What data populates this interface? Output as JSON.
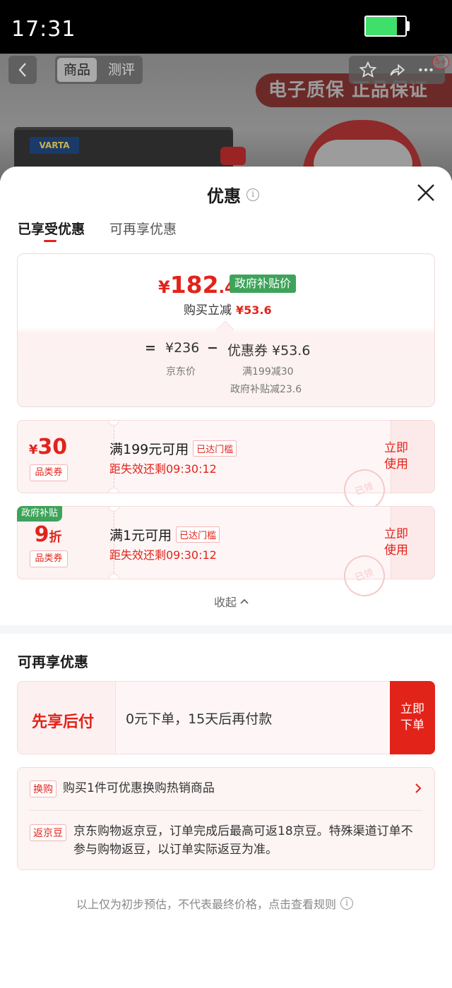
{
  "status_bar": {
    "time": "17:31",
    "battery_level": 0.78
  },
  "product": {
    "nav_tabs": [
      "商品",
      "测评"
    ],
    "banner_text": "电子质保 正品保证",
    "notification_count": "5+",
    "battery_brand": "VARTA"
  },
  "sheet": {
    "title": "优惠",
    "tabs": [
      "已享受优惠",
      "可再享优惠"
    ],
    "active_tab": "已享受优惠"
  },
  "summary": {
    "final_price_symbol": "¥",
    "final_price_int": "182",
    "final_price_dec": ".4",
    "gov_tag": "政府补贴价",
    "save_label": "购买立减",
    "save_amount": "¥53.6",
    "equals": "=",
    "jd_price": "¥236",
    "minus": "−",
    "coupon_total": "优惠券 ¥53.6",
    "jd_price_label": "京东价",
    "detail_1": "满199减30",
    "detail_2": "政府补贴减23.6"
  },
  "coupons": [
    {
      "value_symbol": "¥",
      "value": "30",
      "type": "品类券",
      "condition": "满199元可用",
      "threshold": "已达门槛",
      "expire": "距失效还剩09:30:12",
      "use_label": "立即使用",
      "stamp": "已领"
    },
    {
      "badge": "政府补贴",
      "value": "9",
      "value_unit": "折",
      "type": "品类券",
      "condition": "满1元可用",
      "threshold": "已达门槛",
      "expire": "距失效还剩09:30:12",
      "use_label": "立即使用",
      "stamp": "已领"
    }
  ],
  "collapse_label": "收起",
  "more_section": {
    "title": "可再享优惠",
    "paylater": {
      "title": "先享后付",
      "desc": "0元下单，15天后再付款",
      "button": "立即下单"
    },
    "swap": {
      "tag": "换购",
      "text": "购买1件可优惠换购热销商品"
    },
    "beans": {
      "tag": "返京豆",
      "text": "京东购物返京豆，订单完成后最高可返18京豆。特殊渠道订单不参与购物返豆，以订单实际返豆为准。"
    }
  },
  "footer_note": "以上仅为初步预估，不代表最终价格，点击查看规则",
  "colors": {
    "accent": "#e2231a",
    "gov_green": "#3ea35a"
  }
}
